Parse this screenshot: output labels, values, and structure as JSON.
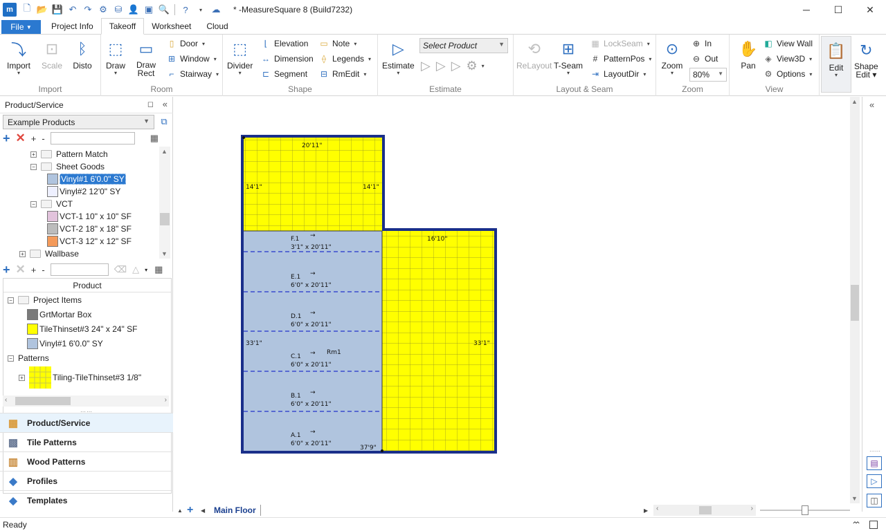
{
  "app": {
    "logo": "m",
    "title": "* -MeasureSquare 8 (Build7232)",
    "window_controls": {
      "minimize": "─",
      "maximize": "☐",
      "close": "✕"
    }
  },
  "tabs": [
    "File",
    "Project Info",
    "Takeoff",
    "Worksheet",
    "Cloud"
  ],
  "active_tab": "Takeoff",
  "ribbon": {
    "import": {
      "label": "Import",
      "buttons": [
        "Import",
        "Scale",
        "Disto"
      ]
    },
    "room": {
      "label": "Room",
      "draw": "Draw",
      "draw_rect_1": "Draw",
      "draw_rect_2": "Rect",
      "door": "Door",
      "window": "Window",
      "stairway": "Stairway"
    },
    "shape": {
      "label": "Shape",
      "divider": "Divider",
      "elevation": "Elevation",
      "dimension": "Dimension",
      "segment": "Segment",
      "note": "Note",
      "legends": "Legends",
      "rmedit": "RmEdit"
    },
    "estimate": {
      "label": "Estimate",
      "estimate": "Estimate",
      "select_product": "Select Product"
    },
    "layout_seam": {
      "label": "Layout & Seam",
      "relayout": "ReLayout",
      "tseam": "T-Seam",
      "lockseam": "LockSeam",
      "patternpos": "PatternPos",
      "layoutdir": "LayoutDir"
    },
    "zoom": {
      "label": "Zoom",
      "zoom": "Zoom",
      "in": "In",
      "out": "Out",
      "value": "80%"
    },
    "view": {
      "label": "View",
      "pan": "Pan",
      "view_wall": "View Wall",
      "view3d": "View3D",
      "options": "Options"
    },
    "edit": {
      "edit": "Edit",
      "shape_edit_1": "Shape",
      "shape_edit_2": "Edit"
    }
  },
  "left_panel": {
    "title": "Product/Service",
    "catalog": "Example Products",
    "tree": [
      {
        "label": "Pattern Match",
        "level": 1,
        "type": "folder",
        "expander": "⊞"
      },
      {
        "label": "Sheet Goods",
        "level": 1,
        "type": "folder",
        "expander": "⊟"
      },
      {
        "label": "Vinyl#1 6'0.0\" SY",
        "level": 2,
        "type": "item",
        "color": "#b0c4de",
        "selected": true
      },
      {
        "label": "Vinyl#2 12'0\" SY",
        "level": 2,
        "type": "item",
        "color": "#eef0ff"
      },
      {
        "label": "VCT",
        "level": 1,
        "type": "folder",
        "expander": "⊟"
      },
      {
        "label": "VCT-1 10\" x 10\" SF",
        "level": 2,
        "type": "item",
        "color": "#e2c3dc"
      },
      {
        "label": "VCT-2 18\" x 18\" SF",
        "level": 2,
        "type": "item",
        "color": "#bcbcbc"
      },
      {
        "label": "VCT-3 12\" x 12\" SF",
        "level": 2,
        "type": "item",
        "color": "#f49a5a"
      },
      {
        "label": "Wallbase",
        "level": 0,
        "type": "folder",
        "expander": "⊞"
      }
    ],
    "product_header": "Product",
    "project_items": {
      "label": "Project Items",
      "items": [
        {
          "label": "GrtMortar Box",
          "color": "#7a7a7a"
        },
        {
          "label": "TileThinset#3 24\" x 24\" SF",
          "color": "#ffff00"
        },
        {
          "label": "Vinyl#1 6'0.0\" SY",
          "color": "#b0c4de"
        }
      ]
    },
    "patterns": {
      "label": "Patterns",
      "item": "Tiling-TileThinset#3 1/8\""
    },
    "nav": [
      "Product/Service",
      "Tile Patterns",
      "Wood Patterns",
      "Profiles",
      "Templates"
    ],
    "nav_active": "Product/Service"
  },
  "drawing": {
    "dims": {
      "top": "20'11\"",
      "upper_left": "14'1\"",
      "upper_right": "14'1\"",
      "step": "16'10\"",
      "left": "33'1\"",
      "right": "33'1\"",
      "bottom": "37'9\""
    },
    "room_label": "Rm1",
    "strips": [
      {
        "name": "F.1",
        "size": "3'1\" x 20'11\""
      },
      {
        "name": "E.1",
        "size": "6'0\" x 20'11\""
      },
      {
        "name": "D.1",
        "size": "6'0\" x 20'11\""
      },
      {
        "name": "C.1",
        "size": "6'0\" x 20'11\""
      },
      {
        "name": "B.1",
        "size": "6'0\" x 20'11\""
      },
      {
        "name": "A.1",
        "size": "6'0\" x 20'11\""
      }
    ],
    "arrow": "→",
    "colors": {
      "tile": "#ffff00",
      "vinyl": "#b0c4de",
      "wall": "#1a2f8a",
      "seam": "#2233cc"
    }
  },
  "floor_tab": "Main Floor",
  "status": "Ready"
}
